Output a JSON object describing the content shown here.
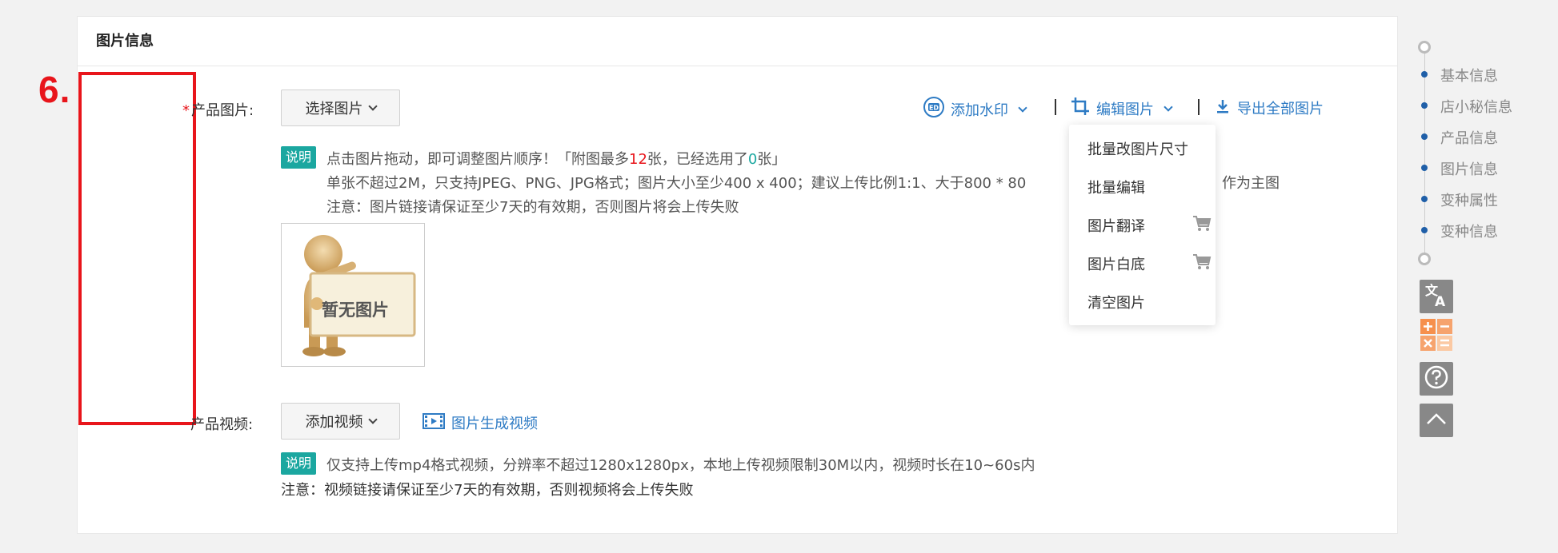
{
  "panel": {
    "title": "图片信息"
  },
  "annotation": {
    "step_label": "6."
  },
  "product_images": {
    "required_mark": "*",
    "label": "产品图片:",
    "select_button": "选择图片",
    "actions": {
      "watermark": "添加水印",
      "edit": "编辑图片",
      "export": "导出全部图片"
    },
    "note_tag": "说明",
    "note_line1_a": "点击图片拖动，即可调整图片顺序！「附图最多",
    "note_line1_max": "12",
    "note_line1_b": "张，已经选用了",
    "note_line1_used": "0",
    "note_line1_c": "张」",
    "note_line2": "单张不超过2M，只支持JPEG、PNG、JPG格式；图片大小至少400 x 400；建议上传比例1:1、大于800 * 80",
    "note_line2_tail": "作为主图",
    "note_line3": "注意：图片链接请保证至少7天的有效期，否则图片将会上传失败",
    "placeholder_text": "暂无图片"
  },
  "edit_menu": {
    "items": [
      "批量改图片尺寸",
      "批量编辑",
      "图片翻译",
      "图片白底",
      "清空图片"
    ]
  },
  "product_video": {
    "label": "产品视频:",
    "add_button": "添加视频",
    "generate_link": "图片生成视频",
    "note_tag": "说明",
    "note_line1": "仅支持上传mp4格式视频，分辨率不超过1280x1280px，本地上传视频限制30M以内，视频时长在10~60s内",
    "note_line2": "注意：视频链接请保证至少7天的有效期，否则视频将会上传失败"
  },
  "side_nav": {
    "items": [
      "基本信息",
      "店小秘信息",
      "产品信息",
      "图片信息",
      "变种属性",
      "变种信息"
    ]
  },
  "colors": {
    "accent": "#2e7bc4",
    "required": "#e8151b",
    "tag": "#1ba7a0",
    "annotation": "#e8151b"
  }
}
